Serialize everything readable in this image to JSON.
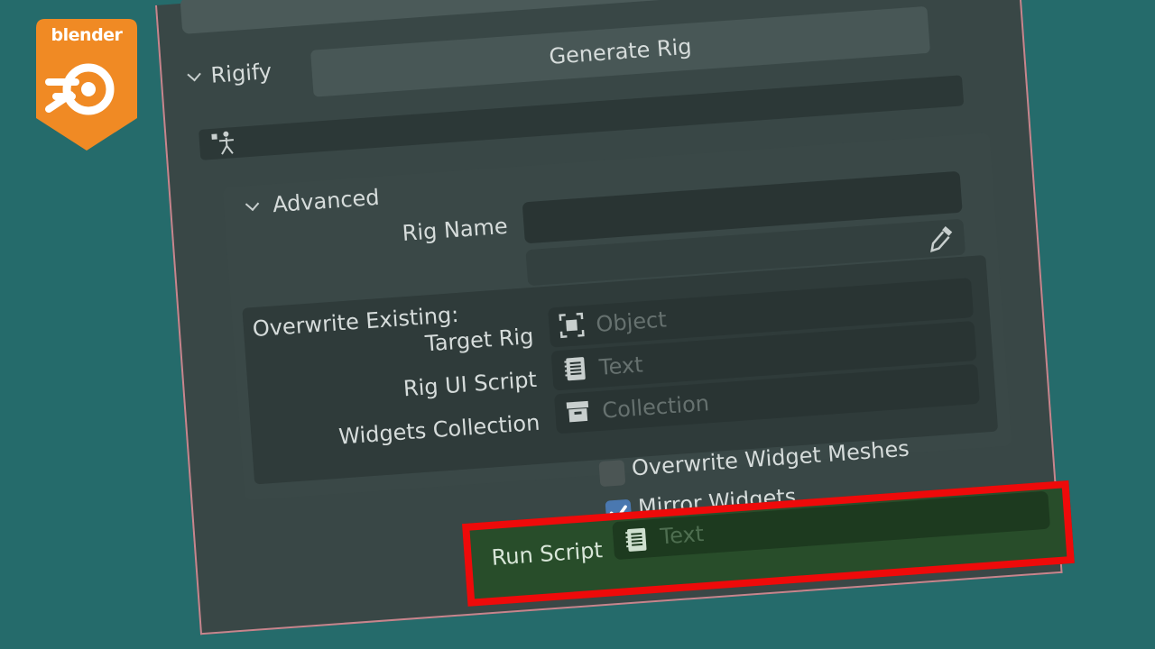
{
  "logo": {
    "word": "blender",
    "color": "#f08a24"
  },
  "panel": {
    "rigify_header": "Rigify",
    "generate_button": "Generate Rig",
    "advanced_header": "Advanced",
    "rig_name": {
      "label": "Rig Name",
      "value": ""
    },
    "overwrite_existing_label": "Overwrite Existing:",
    "target_rig": {
      "label": "Target Rig",
      "placeholder": "Object",
      "icon": "object-icon"
    },
    "rig_ui_script": {
      "label": "Rig UI Script",
      "placeholder": "Text",
      "icon": "text-icon"
    },
    "widgets_collection": {
      "label": "Widgets Collection",
      "placeholder": "Collection",
      "icon": "collection-icon"
    },
    "overwrite_widget_meshes": {
      "label": "Overwrite Widget Meshes",
      "checked": false
    },
    "mirror_widgets": {
      "label": "Mirror Widgets",
      "checked": true
    },
    "run_script": {
      "label": "Run Script",
      "placeholder": "Text",
      "icon": "text-icon"
    }
  },
  "colors": {
    "background": "#256b6b",
    "panel": "#394746",
    "highlight_border": "#ee0a0a",
    "highlight_fill": "#284d2a",
    "checkbox_checked": "#4a78b0"
  }
}
